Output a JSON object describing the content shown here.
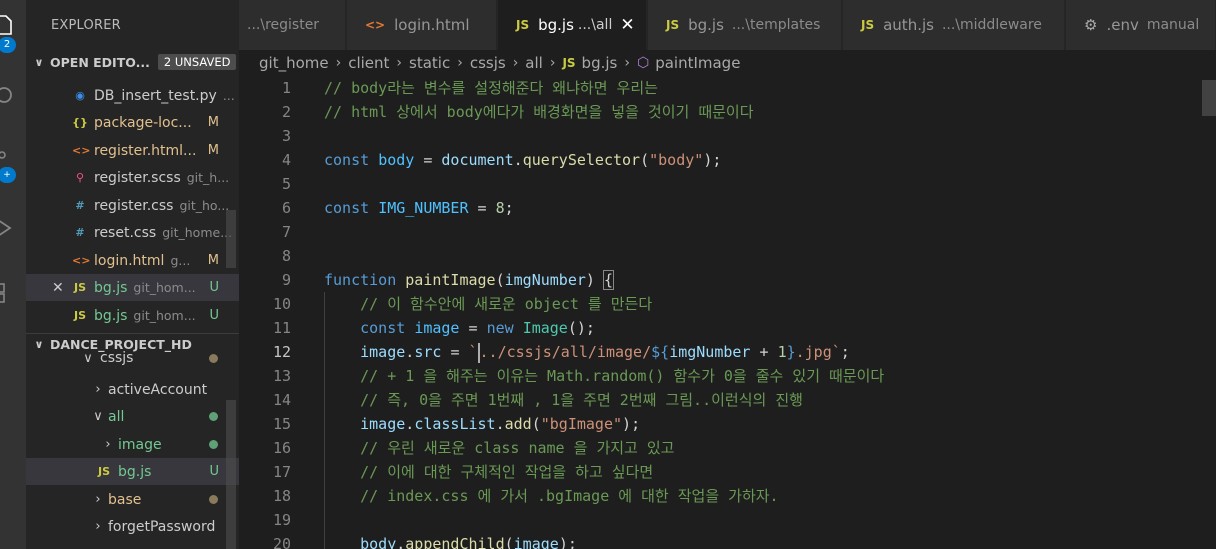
{
  "sidebar": {
    "title": "EXPLORER",
    "open_editors": {
      "label": "OPEN EDITO...",
      "unsaved_badge": "2 UNSAVED",
      "items": [
        {
          "icon": "python-file-icon",
          "name": "DB_insert_test.py",
          "desc": "...",
          "status": "",
          "state": "normal"
        },
        {
          "icon": "json-file-icon",
          "name": "package-loc...",
          "desc": "",
          "status": "M",
          "state": "modified"
        },
        {
          "icon": "html-file-icon",
          "name": "register.html...",
          "desc": "",
          "status": "M",
          "state": "modified"
        },
        {
          "icon": "sass-file-icon",
          "name": "register.scss",
          "desc": "git_h...",
          "status": "",
          "state": "normal"
        },
        {
          "icon": "css-file-icon",
          "name": "register.css",
          "desc": "git_ho...",
          "status": "",
          "state": "normal"
        },
        {
          "icon": "css-file-icon",
          "name": "reset.css",
          "desc": "git_home...",
          "status": "",
          "state": "normal"
        },
        {
          "icon": "html-file-icon",
          "name": "login.html",
          "desc": "g...",
          "status": "M",
          "state": "modified"
        },
        {
          "icon": "js-file-icon",
          "name": "bg.js",
          "desc": "git_hom...",
          "status": "U",
          "state": "untracked"
        },
        {
          "icon": "js-file-icon",
          "name": "bg.js",
          "desc": "git_hom...",
          "status": "U",
          "state": "untracked"
        }
      ]
    },
    "project": {
      "label": "DANCE_PROJECT_HD",
      "tree": [
        {
          "name": "cssjs",
          "status": ""
        },
        {
          "name": "activeAccount",
          "status": ""
        },
        {
          "name": "all",
          "status": ""
        },
        {
          "name": "image",
          "status": ""
        },
        {
          "name": "bg.js",
          "status": "U"
        },
        {
          "name": "base",
          "status": ""
        },
        {
          "name": "forgetPassword",
          "status": ""
        }
      ]
    },
    "activity_badges": [
      "2"
    ]
  },
  "tabs": [
    {
      "icon": "",
      "name": "",
      "desc": "...\\register",
      "active": false
    },
    {
      "icon": "<>",
      "name": "login.html",
      "desc": "",
      "active": false
    },
    {
      "icon": "JS",
      "name": "bg.js",
      "desc": "...\\all",
      "active": true
    },
    {
      "icon": "JS",
      "name": "bg.js",
      "desc": "...\\templates",
      "active": false
    },
    {
      "icon": "JS",
      "name": "auth.js",
      "desc": "...\\middleware",
      "active": false
    },
    {
      "icon": "gear-icon",
      "name": ".env",
      "desc": "manual",
      "active": false
    }
  ],
  "tab_close_glyph": "✕",
  "breadcrumb": [
    "git_home",
    "client",
    "static",
    "cssjs",
    "all",
    "bg.js",
    "paintImage"
  ],
  "editor": {
    "lines": [
      {
        "n": "1",
        "text": "// body라는 변수를 설정해준다 왜냐하면 우리는"
      },
      {
        "n": "2",
        "text": "// html 상에서 body에다가 배경화면을 넣을 것이기 때문이다"
      },
      {
        "n": "3",
        "text": ""
      },
      {
        "n": "4",
        "text": "const body = document.querySelector(\"body\");"
      },
      {
        "n": "5",
        "text": ""
      },
      {
        "n": "6",
        "text": "const IMG_NUMBER = 8;"
      },
      {
        "n": "7",
        "text": ""
      },
      {
        "n": "8",
        "text": ""
      },
      {
        "n": "9",
        "text": "function paintImage(imgNumber) {"
      },
      {
        "n": "10",
        "text": "    // 이 함수안에 새로운 object 를 만든다"
      },
      {
        "n": "11",
        "text": "    const image = new Image();"
      },
      {
        "n": "12",
        "text": "    image.src = `../cssjs/all/image/${imgNumber + 1}.jpg`;"
      },
      {
        "n": "13",
        "text": "    // + 1 을 해주는 이유는 Math.random() 함수가 0을 줄수 있기 때문이다"
      },
      {
        "n": "14",
        "text": "    // 즉, 0을 주면 1번째 , 1을 주면 2번째 그림..이런식의 진행"
      },
      {
        "n": "15",
        "text": "    image.classList.add(\"bgImage\");"
      },
      {
        "n": "16",
        "text": "    // 우린 새로운 class name 을 가지고 있고"
      },
      {
        "n": "17",
        "text": "    // 이에 대한 구체적인 작업을 하고 싶다면"
      },
      {
        "n": "18",
        "text": "    // index.css 에 가서 .bgImage 에 대한 작업을 가하자."
      },
      {
        "n": "19",
        "text": ""
      },
      {
        "n": "20",
        "text": "    body.appendChild(image);"
      }
    ]
  },
  "colors": {
    "comment": "#6a9955",
    "keyword": "#569cd6",
    "function": "#dcdcaa",
    "string": "#ce9178",
    "number": "#b5cea8",
    "modified": "#e2c08d",
    "untracked": "#73c991",
    "accent": "#007acc"
  }
}
